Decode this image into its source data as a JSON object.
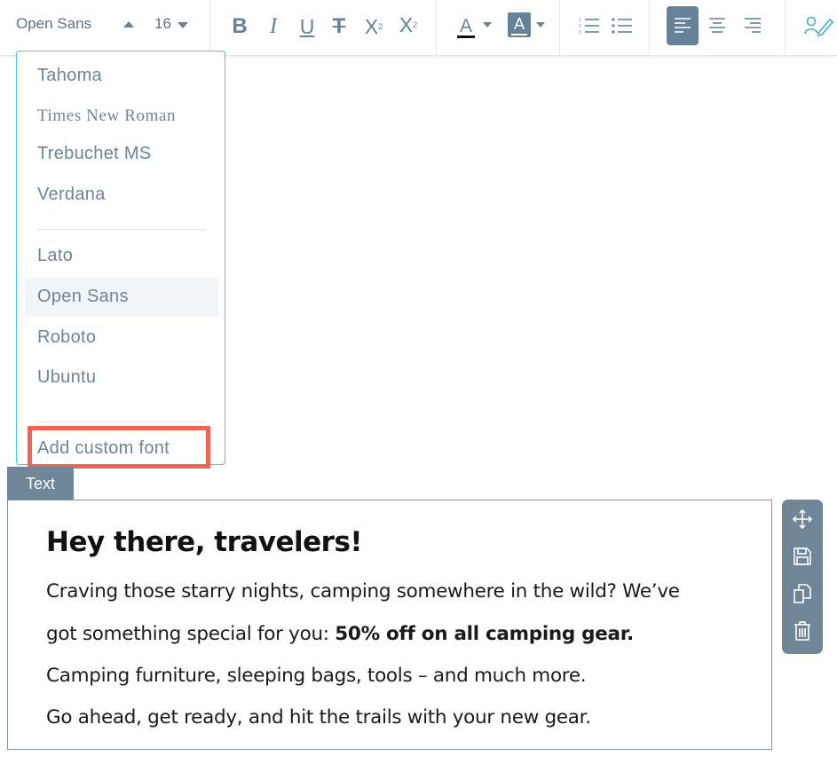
{
  "toolbar": {
    "font_family": "Open Sans",
    "font_size": "16",
    "bold": "B",
    "italic": "I",
    "underline": "U",
    "strikethrough": "T",
    "subscript": "X",
    "subscript_mark": "2",
    "superscript": "X",
    "superscript_mark": "2",
    "font_color_letter": "A",
    "highlight_letter": "A",
    "active_alignment": "left",
    "accent_color": "#66819a"
  },
  "font_dropdown": {
    "system_fonts": [
      "Tahoma",
      "Times New Roman",
      "Trebuchet MS",
      "Verdana"
    ],
    "web_fonts": [
      "Lato",
      "Open Sans",
      "Roboto",
      "Ubuntu"
    ],
    "selected": "Open Sans",
    "custom_action": "Add custom font",
    "border_color": "#3fc6e4",
    "highlight_color": "#f26352"
  },
  "block": {
    "tag": "Text",
    "title": "Hey there, travelers!",
    "line1": "Craving those starry nights, camping somewhere in the wild? We’ve",
    "line2_prefix": "got something special for you: ",
    "line2_bold": "50% off on all camping gear.",
    "line3": "Camping furniture, sleeping bags, tools – and much more.",
    "line4": "Go ahead, get ready, and hit the trails with your new gear."
  },
  "sidebar": {
    "icons": [
      "move-icon",
      "save-icon",
      "duplicate-icon",
      "delete-icon"
    ]
  }
}
